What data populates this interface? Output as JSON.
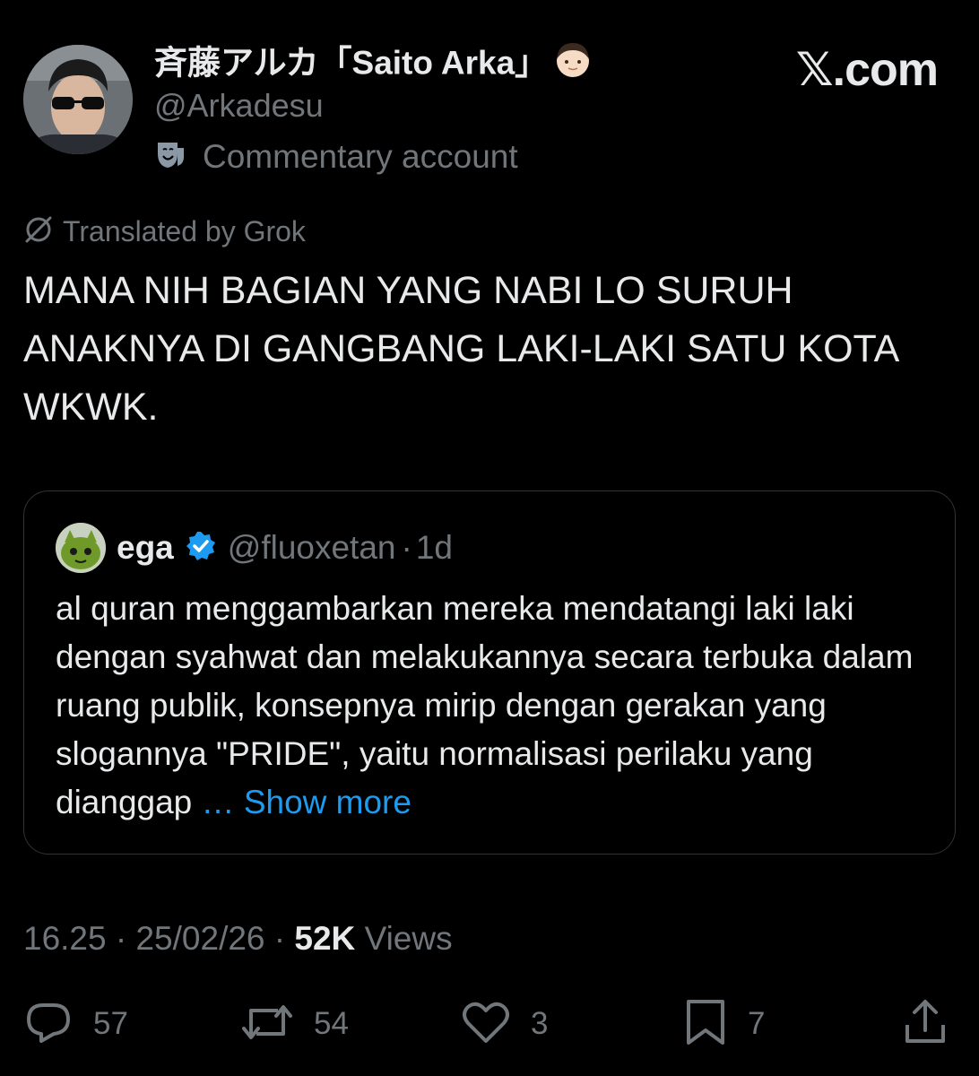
{
  "author": {
    "display_name": "斉藤アルカ「Saito Arka」",
    "display_emoji": "👦🏻",
    "handle": "@Arkadesu",
    "account_label": "Commentary account",
    "account_icon": "theater-masks-icon"
  },
  "site": {
    "logo_text": "𝕏.com"
  },
  "translation": {
    "label": "Translated by Grok",
    "icon": "grok-slash-circle-icon"
  },
  "tweet": {
    "text": "MANA NIH BAGIAN YANG NABI LO SURUH ANAKNYA DI GANGBANG LAKI-LAKI SATU KOTA WKWK."
  },
  "quote": {
    "name": "ega",
    "verified": true,
    "handle": "@fluoxetan",
    "separator": "·",
    "time": "1d",
    "text": "al quran menggambarkan mereka mendatangi laki laki dengan syahwat dan melakukannya secara terbuka dalam ruang publik, konsepnya mirip dengan gerakan yang slogannya \"PRIDE\", yaitu normalisasi perilaku yang dianggap ",
    "show_more": "… Show more"
  },
  "meta": {
    "time": "16.25",
    "dot1": " · ",
    "date": "25/02/26",
    "dot2": " · ",
    "views_count": "52K",
    "views_label": " Views"
  },
  "actions": {
    "replies": "57",
    "reposts": "54",
    "likes": "3",
    "bookmarks": "7"
  },
  "colors": {
    "background": "#000000",
    "text_primary": "#e7e9ea",
    "text_secondary": "#71767b",
    "accent": "#1d9bf0",
    "border": "#2f3336"
  }
}
